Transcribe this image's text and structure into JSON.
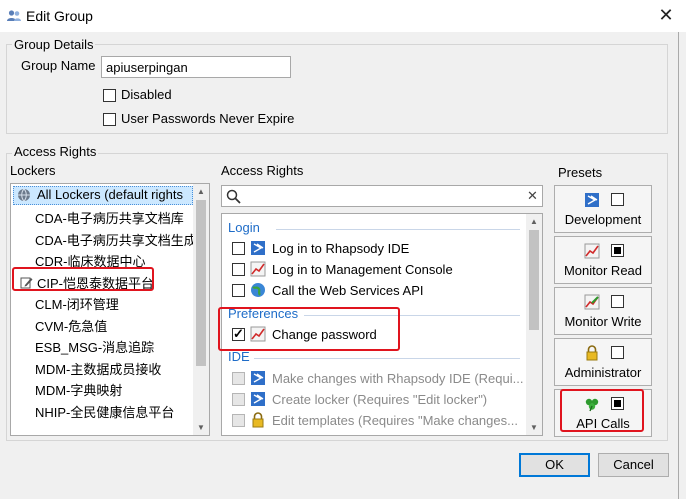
{
  "window": {
    "title": "Edit Group"
  },
  "group_details": {
    "legend": "Group Details",
    "group_name_label": "Group Name",
    "group_name_value": "apiuserpingan",
    "disabled_label": "Disabled",
    "never_expire_label": "User Passwords Never Expire"
  },
  "access_rights_group": {
    "legend": "Access Rights"
  },
  "lockers": {
    "header": "Lockers",
    "items": [
      {
        "label": "All Lockers (default rights"
      },
      {
        "label": "CDA-电子病历共享文档库"
      },
      {
        "label": "CDA-电子病历共享文档生成"
      },
      {
        "label": "CDR-临床数据中心"
      },
      {
        "label": "CIP-恺恩泰数据平台"
      },
      {
        "label": "CLM-闭环管理"
      },
      {
        "label": "CVM-危急值"
      },
      {
        "label": "ESB_MSG-消息追踪"
      },
      {
        "label": "MDM-主数据成员接收"
      },
      {
        "label": "MDM-字典映射"
      },
      {
        "label": "NHIP-全民健康信息平台"
      }
    ]
  },
  "rights": {
    "header": "Access Rights",
    "search_value": "",
    "clear_glyph": "✕",
    "sections": {
      "login": "Login",
      "preferences": "Preferences",
      "ide": "IDE"
    },
    "items": [
      {
        "label": "Log in to Rhapsody IDE",
        "checked": false,
        "enabled": true
      },
      {
        "label": "Log in to Management Console",
        "checked": false,
        "enabled": true
      },
      {
        "label": "Call the Web Services API",
        "checked": false,
        "enabled": true
      },
      {
        "label": "Change password",
        "checked": true,
        "enabled": true
      },
      {
        "label": "Make changes with Rhapsody IDE (Requi...",
        "checked": false,
        "enabled": false
      },
      {
        "label": "Create locker (Requires \"Edit locker\")",
        "checked": false,
        "enabled": false
      },
      {
        "label": "Edit templates (Requires \"Make changes...",
        "checked": false,
        "enabled": false
      }
    ]
  },
  "presets": {
    "header": "Presets",
    "items": [
      {
        "label": "Development",
        "checked": false
      },
      {
        "label": "Monitor Read",
        "checked": true
      },
      {
        "label": "Monitor Write",
        "checked": false
      },
      {
        "label": "Administrator",
        "checked": false
      },
      {
        "label": "API Calls",
        "checked": true
      }
    ]
  },
  "buttons": {
    "ok": "OK",
    "cancel": "Cancel"
  },
  "colors": {
    "highlight_red": "#e0141e",
    "section_blue": "#1e6cc8",
    "selection": "#cce8ff",
    "ok_border": "#0078d7"
  }
}
